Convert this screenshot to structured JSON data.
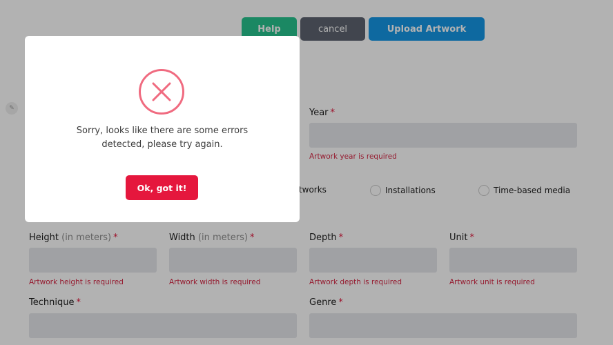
{
  "toolbar": {
    "help_label": "Help",
    "cancel_label": "cancel",
    "upload_label": "Upload Artwork"
  },
  "form": {
    "year": {
      "label": "Year",
      "required": "*",
      "error": "Artwork year is required"
    },
    "types": [
      {
        "label": "rtworks"
      },
      {
        "label": "Installations"
      },
      {
        "label": "Time-based media"
      }
    ],
    "height": {
      "label": "Height",
      "hint": "(in meters)",
      "required": "*",
      "error": "Artwork height is required"
    },
    "width": {
      "label": "Width",
      "hint": "(in meters)",
      "required": "*",
      "error": "Artwork width is required"
    },
    "depth": {
      "label": "Depth",
      "required": "*",
      "error": "Artwork depth is required"
    },
    "unit": {
      "label": "Unit",
      "required": "*",
      "error": "Artwork unit is required"
    },
    "technique": {
      "label": "Technique",
      "required": "*"
    },
    "genre": {
      "label": "Genre",
      "required": "*"
    }
  },
  "modal": {
    "icon": "error-x-circle-icon",
    "message_line1": "Sorry, looks like there are some errors",
    "message_line2": "detected, please try again.",
    "ok_label": "Ok, got it!"
  },
  "colors": {
    "help": "#28c38e",
    "cancel": "#5e6470",
    "upload": "#1597e5",
    "error": "#e5173d",
    "error_icon": "#f06b80"
  }
}
